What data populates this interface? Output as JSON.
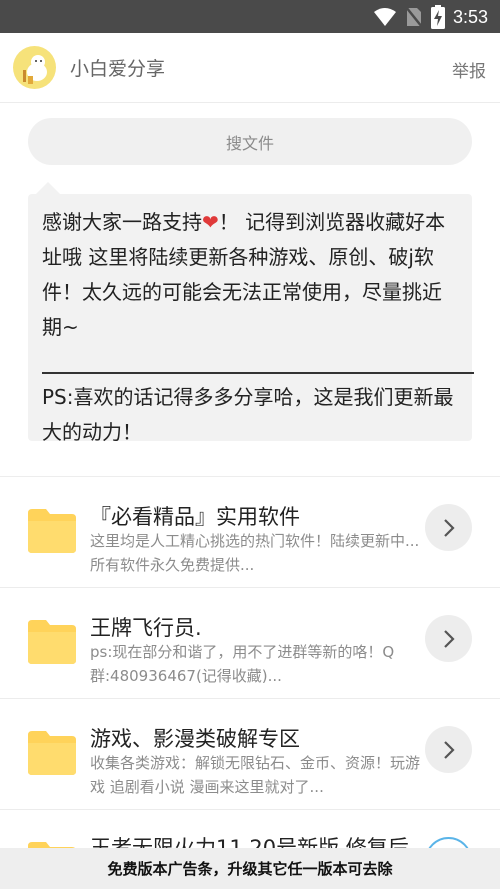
{
  "status_bar": {
    "time": "3:53",
    "icons": [
      "wifi-icon",
      "no-sim-icon",
      "battery-charging-icon"
    ]
  },
  "header": {
    "title": "小白爱分享",
    "report_label": "举报",
    "avatar_icon": "mascot-avatar-icon"
  },
  "search": {
    "placeholder": "搜文件"
  },
  "notice": {
    "text_before_heart": "感谢大家一路支持",
    "heart": "❤",
    "text_after_heart": "！ 记得到浏览器收藏好本址哦 这里将陆续更新各种游戏、原创、破j软件！太久远的可能会无法正常使用，尽量挑近期~",
    "ps": "PS:喜欢的话记得多多分享哈，这是我们更新最大的动力！"
  },
  "items": [
    {
      "title": "『必看精品』实用软件",
      "desc": "这里均是人工精心挑选的热门软件！陆续更新中...所有软件永久免费提供...",
      "icon": "folder-icon"
    },
    {
      "title": "王牌飞行员.",
      "desc": "ps:现在部分和谐了，用不了进群等新的咯！Q群:480936467(记得收藏)...",
      "icon": "folder-icon"
    },
    {
      "title": "游戏、影漫类破解专区",
      "desc": "收集各类游戏：解锁无限钻石、金币、资源！玩游戏 追剧看小说 漫画来这里就对了...",
      "icon": "folder-icon"
    },
    {
      "title": "王者无限火力11.20号新版 修复后",
      "icon": "folder-icon"
    }
  ],
  "ad_bar": {
    "text": "免费版本广告条，升级其它任一版本可去除"
  },
  "colors": {
    "folder": "#ffd35a",
    "heart": "#e03a3a",
    "accent_circle": "#5ab4e8"
  }
}
